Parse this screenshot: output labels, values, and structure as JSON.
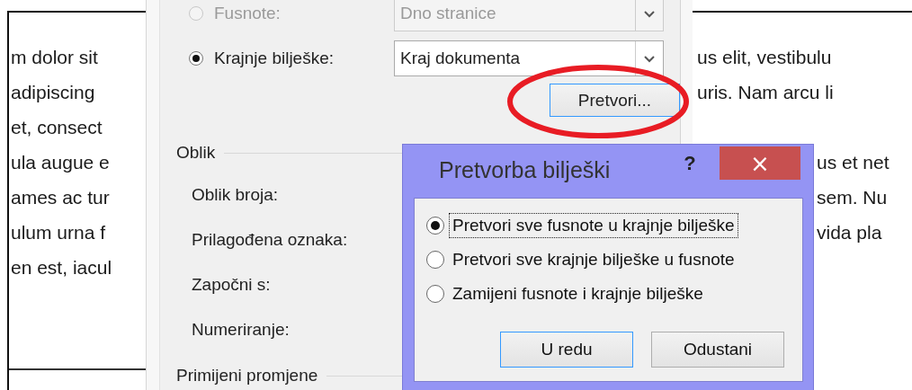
{
  "document": {
    "left_lines": [
      "m dolor sit",
      "adipiscing",
      "et, consect",
      "ula augue e",
      "ames ac tur",
      "ulum urna f",
      "en est, iacul"
    ],
    "right_paragraphs": [
      [
        "us elit, vestibulu",
        "uris. Nam arcu li"
      ],
      [
        "us et net",
        "sem. Nu",
        "vida pla"
      ]
    ]
  },
  "options_dialog": {
    "location_rows": [
      {
        "label": "Fusnote:",
        "selected": false,
        "disabled": true,
        "value": "Dno stranice"
      },
      {
        "label": "Krajnje bilješke:",
        "selected": true,
        "disabled": false,
        "value": "Kraj dokumenta"
      }
    ],
    "convert_button": "Pretvori...",
    "format_section": "Oblik",
    "format_fields": [
      "Oblik broja:",
      "Prilagođena oznaka:",
      "Započni s:",
      "Numeriranje:"
    ],
    "apply_section": "Primijeni promjene"
  },
  "convert_dialog": {
    "title": "Pretvorba bilješki",
    "help": "?",
    "close": "×",
    "options": [
      {
        "label": "Pretvori sve fusnote u krajnje bilješke",
        "selected": true,
        "focused": true
      },
      {
        "label": "Pretvori sve krajnje bilješke u fusnote",
        "selected": false,
        "focused": false
      },
      {
        "label": "Zamijeni fusnote i krajnje bilješke",
        "selected": false,
        "focused": false
      }
    ],
    "buttons": [
      {
        "label": "U redu",
        "default": true
      },
      {
        "label": "Odustani",
        "default": false
      }
    ]
  }
}
